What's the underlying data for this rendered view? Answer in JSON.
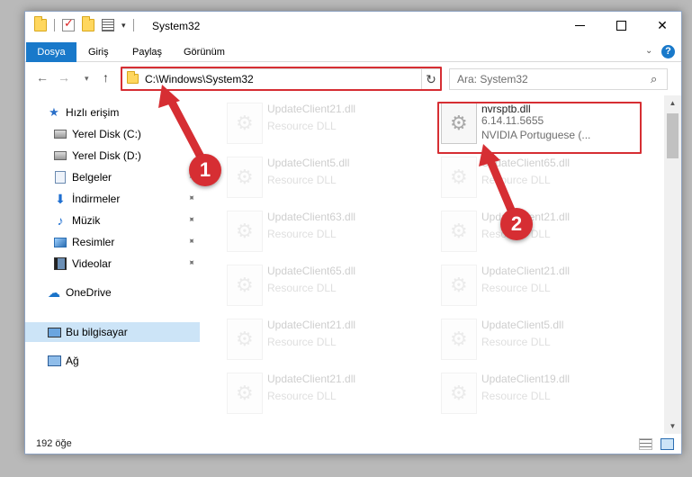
{
  "window": {
    "title": "System32",
    "minimize_glyph": "",
    "close_glyph": "✕"
  },
  "ribbon": {
    "tabs": [
      "Dosya",
      "Giriş",
      "Paylaş",
      "Görünüm"
    ],
    "expand_glyph": "⌄",
    "help_glyph": "?"
  },
  "nav": {
    "back_glyph": "←",
    "forward_glyph": "→",
    "recent_glyph": "▾",
    "up_glyph": "↑",
    "address": "C:\\Windows\\System32",
    "address_chevron": "⌄",
    "refresh_glyph": "↻",
    "search_placeholder": "Ara: System32",
    "search_glyph": "⌕"
  },
  "sidebar": {
    "items": [
      {
        "label": "Hızlı erişim",
        "icon": "star-icon",
        "pinned": false
      },
      {
        "label": "Yerel Disk (C:)",
        "icon": "drive-icon",
        "pinned": true
      },
      {
        "label": "Yerel Disk (D:)",
        "icon": "drive-icon",
        "pinned": true
      },
      {
        "label": "Belgeler",
        "icon": "documents-icon",
        "pinned": true
      },
      {
        "label": "İndirmeler",
        "icon": "downloads-icon",
        "pinned": true
      },
      {
        "label": "Müzik",
        "icon": "music-icon",
        "pinned": true
      },
      {
        "label": "Resimler",
        "icon": "pictures-icon",
        "pinned": true
      },
      {
        "label": "Videolar",
        "icon": "videos-icon",
        "pinned": true
      },
      {
        "label": "OneDrive",
        "icon": "cloud-icon",
        "pinned": false
      },
      {
        "label": "Bu bilgisayar",
        "icon": "computer-icon",
        "pinned": false
      },
      {
        "label": "Ağ",
        "icon": "network-icon",
        "pinned": false
      }
    ],
    "pin_glyph": "📌",
    "star_glyph": "★",
    "download_glyph": "⬇",
    "music_glyph": "♪",
    "cloud_glyph": "☁"
  },
  "files": [
    {
      "name": "UpdateClient21.dll",
      "desc": "Resource DLL",
      "faded": true
    },
    {
      "name": "nvrsptb.dll",
      "desc": "6.14.11.5655",
      "desc2": "NVIDIA Portuguese (...",
      "faded": false
    },
    {
      "name": "UpdateClient5.dll",
      "desc": "Resource DLL",
      "faded": true
    },
    {
      "name": "UpdateClient65.dll",
      "desc": "Resource DLL",
      "faded": true
    },
    {
      "name": "UpdateClient63.dll",
      "desc": "Resource DLL",
      "faded": true
    },
    {
      "name": "UpdateClient21.dll",
      "desc": "Resource DLL",
      "faded": true
    },
    {
      "name": "UpdateClient65.dll",
      "desc": "Resource DLL",
      "faded": true
    },
    {
      "name": "UpdateClient21.dll",
      "desc": "Resource DLL",
      "faded": true
    },
    {
      "name": "UpdateClient21.dll",
      "desc": "Resource DLL",
      "faded": true
    },
    {
      "name": "UpdateClient5.dll",
      "desc": "Resource DLL",
      "faded": true
    },
    {
      "name": "UpdateClient21.dll",
      "desc": "Resource DLL",
      "faded": true
    },
    {
      "name": "UpdateClient19.dll",
      "desc": "Resource DLL",
      "faded": true
    }
  ],
  "scrollbar": {
    "up_glyph": "▲",
    "down_glyph": "▼"
  },
  "status": {
    "item_count": "192 öğe"
  },
  "annotations": {
    "marker1": "1",
    "marker2": "2",
    "color": "#d62e33"
  }
}
